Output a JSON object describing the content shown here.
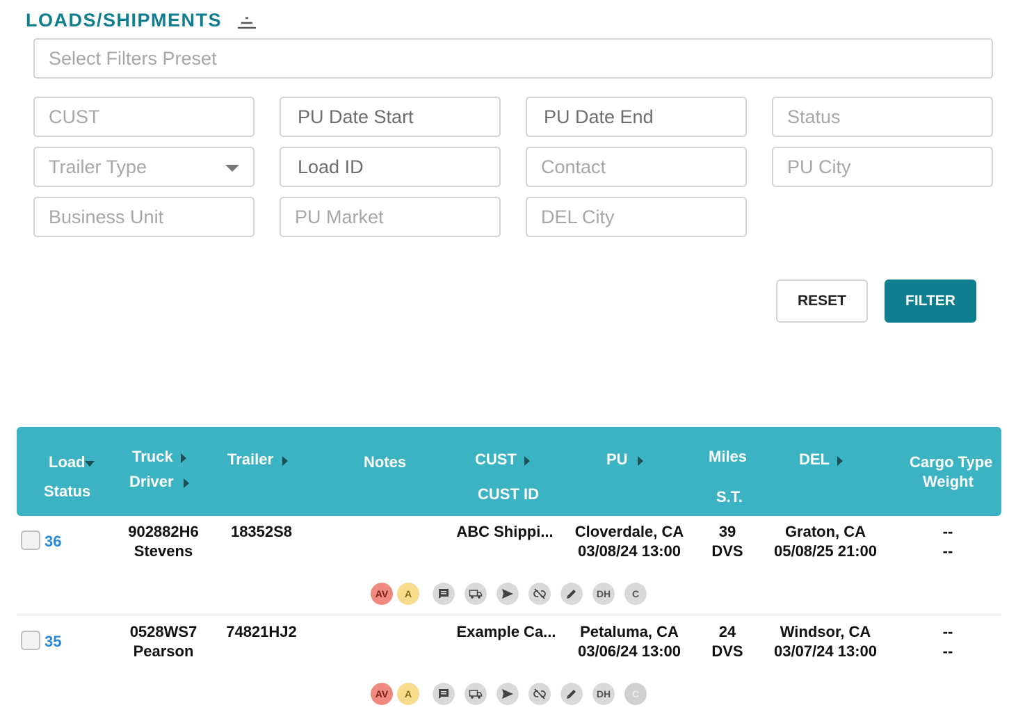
{
  "header": {
    "title": "LOADS/SHIPMENTS",
    "collapse_icon": "collapse-lines-icon"
  },
  "filters": {
    "preset_placeholder": "Select Filters Preset",
    "cust": "CUST",
    "pu_date_start": "PU Date Start",
    "pu_date_end": "PU Date End",
    "status": "Status",
    "trailer_type": "Trailer Type",
    "load_id": "Load ID",
    "contact": "Contact",
    "pu_city": "PU City",
    "business_unit": "Business Unit",
    "pu_market": "PU Market",
    "del_city": "DEL City"
  },
  "actions": {
    "reset": "RESET",
    "filter": "FILTER"
  },
  "colors": {
    "accent": "#0f7f8f",
    "table_header": "#3bb3c3",
    "link": "#2a88d6",
    "av_badge": "#f08a80",
    "a_badge": "#f8dc8e"
  },
  "table": {
    "headers": {
      "load": "Load",
      "status": "Status",
      "truck": "Truck",
      "driver": "Driver",
      "trailer": "Trailer",
      "notes": "Notes",
      "cust": "CUST",
      "cust_id": "CUST ID",
      "pu": "PU",
      "miles": "Miles",
      "st": "S.T.",
      "del": "DEL",
      "cargo_type": "Cargo Type",
      "weight": "Weight"
    },
    "rows": [
      {
        "load": "36",
        "truck": "902882H6",
        "driver": "Stevens",
        "trailer": "18352S8",
        "cust": "ABC Shippi...",
        "pu_city": "Cloverdale, CA",
        "pu_date": "03/08/24 13:00",
        "miles": "39",
        "st": "DVS",
        "del_city": "Graton, CA",
        "del_date": "05/08/25 21:00",
        "cargo_type": "--",
        "weight": "--",
        "badges": {
          "av": "AV",
          "a": "A",
          "dh": "DH",
          "c": "C"
        }
      },
      {
        "load": "35",
        "truck": "0528WS7",
        "driver": "Pearson",
        "trailer": "74821HJ2",
        "cust": "Example Ca...",
        "pu_city": "Petaluma, CA",
        "pu_date": "03/06/24 13:00",
        "miles": "24",
        "st": "DVS",
        "del_city": "Windsor, CA",
        "del_date": "03/07/24 13:00",
        "cargo_type": "--",
        "weight": "--",
        "badges": {
          "av": "AV",
          "a": "A",
          "dh": "DH",
          "c": "C"
        }
      }
    ]
  }
}
